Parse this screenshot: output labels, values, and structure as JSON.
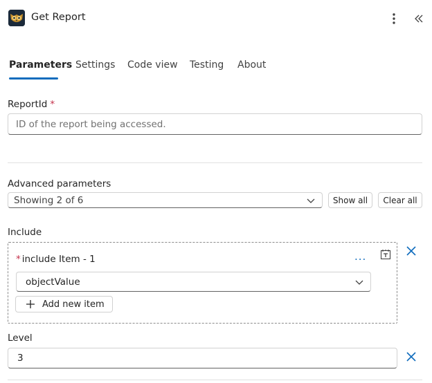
{
  "header": {
    "title": "Get Report",
    "logo_icon": "owl-logo-icon",
    "more_icon": "more-vertical-icon",
    "collapse_icon": "double-chevron-left-icon"
  },
  "tabs": [
    {
      "label": "Parameters",
      "active": true
    },
    {
      "label": "Settings"
    },
    {
      "label": "Code view"
    },
    {
      "label": "Testing"
    },
    {
      "label": "About"
    }
  ],
  "report_id": {
    "label": "ReportId",
    "required_mark": "*",
    "placeholder": "ID of the report being accessed.",
    "value": ""
  },
  "advanced": {
    "label": "Advanced parameters",
    "selected": "Showing 2 of 6",
    "show_all_label": "Show all",
    "clear_all_label": "Clear all"
  },
  "include": {
    "label": "Include",
    "item_required_mark": "*",
    "item_label": "include Item - 1",
    "more_label": "...",
    "item_value": "objectValue",
    "add_item_label": "Add new item"
  },
  "level": {
    "label": "Level",
    "value": "3"
  },
  "colors": {
    "accent": "#0f6cbd",
    "required": "#c4314b"
  }
}
